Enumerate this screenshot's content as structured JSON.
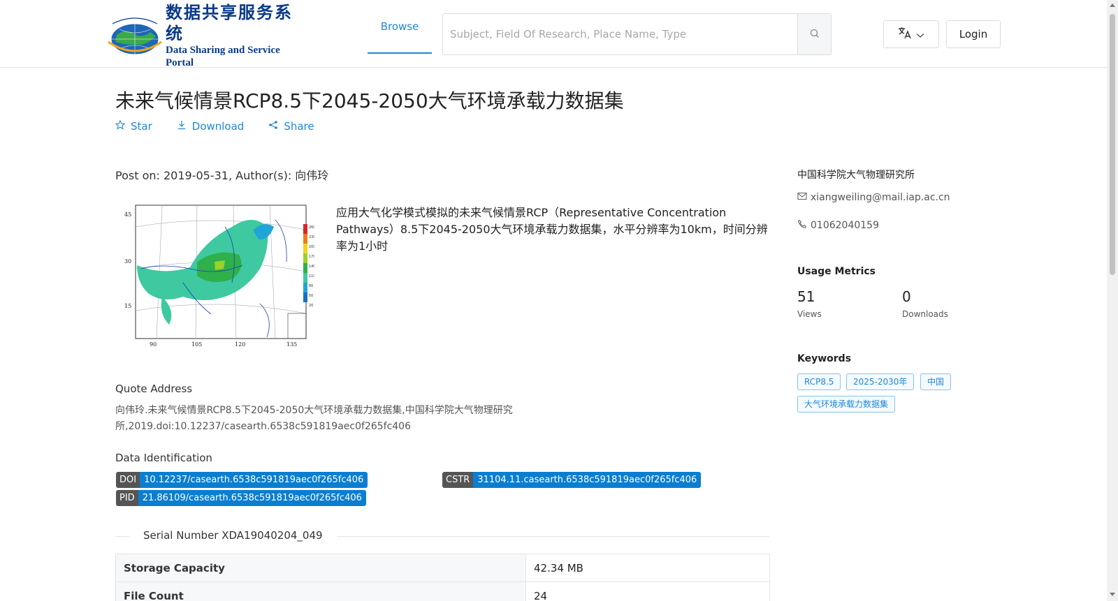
{
  "header": {
    "logo_cn": "数据共享服务系统",
    "logo_en": "Data Sharing and Service Portal",
    "nav_browse": "Browse",
    "search_placeholder": "Subject, Field Of Research, Place Name, Type",
    "login_label": "Login"
  },
  "dataset": {
    "title": "未来气候情景RCP8.5下2045-2050大气环境承载力数据集",
    "actions": {
      "star": "Star",
      "download": "Download",
      "share": "Share"
    },
    "post_info": "Post on: 2019-05-31, Author(s): 向伟玲",
    "description": "应用大气化学模式模拟的未来气候情景RCP（Representative Concentration Pathways）8.5下2045-2050大气环境承载力数据集，水平分辨率为10km，时间分辨率为1小时",
    "thumbnail_labels": {
      "y": [
        "45",
        "30",
        "15"
      ],
      "x": [
        "90",
        "105",
        "120",
        "135"
      ],
      "legend": [
        "260",
        "230",
        "200",
        "170",
        "140",
        "110",
        "80",
        "50",
        "20"
      ]
    },
    "quote_label": "Quote Address",
    "quote_text": "向伟玲.未来气候情景RCP8.5下2045-2050大气环境承载力数据集,中国科学院大气物理研究所,2019.doi:10.12237/casearth.6538c591819aec0f265fc406",
    "identification_label": "Data Identification",
    "identifiers": {
      "doi": {
        "key": "DOI",
        "value": "10.12237/casearth.6538c591819aec0f265fc406"
      },
      "cstr": {
        "key": "CSTR",
        "value": "31104.11.casearth.6538c591819aec0f265fc406"
      },
      "pid": {
        "key": "PID",
        "value": "21.86109/casearth.6538c591819aec0f265fc406"
      }
    },
    "serial_number": "Serial Number XDA19040204_049",
    "info_table": [
      {
        "key": "Storage Capacity",
        "value": "42.34 MB"
      },
      {
        "key": "File Count",
        "value": "24"
      }
    ]
  },
  "sidebar": {
    "org": "中国科学院大气物理研究所",
    "email": "xiangweiling@mail.iap.ac.cn",
    "phone": "01062040159",
    "usage_title": "Usage Metrics",
    "views_value": "51",
    "views_label": "Views",
    "downloads_value": "0",
    "downloads_label": "Downloads",
    "keywords_title": "Keywords",
    "keywords": [
      "RCP8.5",
      "2025-2030年",
      "中国",
      "大气环境承载力数据集"
    ]
  },
  "colors": {
    "accent": "#1f88d6",
    "tag_value": "#0a7ed1",
    "tag_key": "#555555",
    "logo_blue": "#0b3a8a"
  }
}
